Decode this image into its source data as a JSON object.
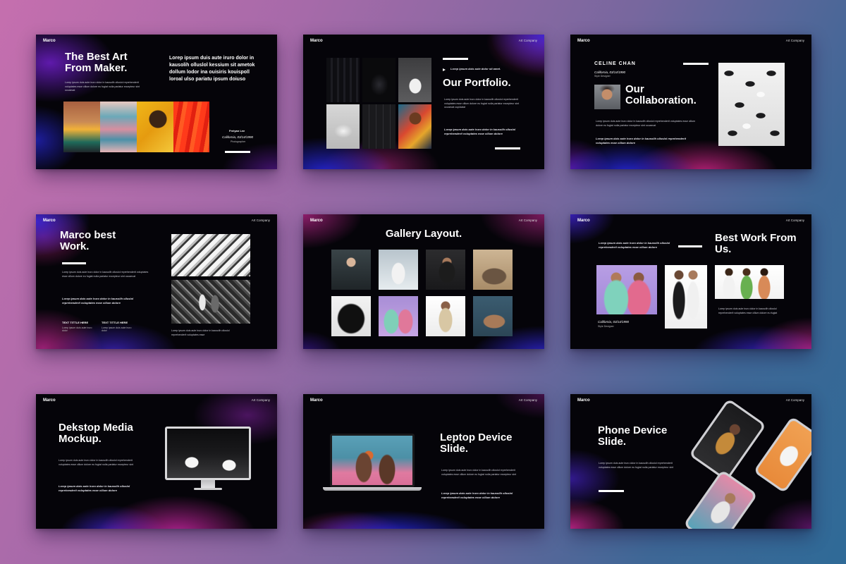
{
  "slides": [
    {
      "brand": "Marco",
      "title": "The Best Art From Maker.",
      "lead": "Lorep ipsum duis aute iruro dolor in kausolih olluslol kessium sit ametok dollum lodor ina ouisiris kouispoll loroal ulso pariatu ipsum doiuso",
      "body": "Lorep ipsum duis aute iruro dolor in kausolih olluslol reprehenderit voluptates esse cillum dolore eu fugiat nulla pariatur excepteur sint occaecat",
      "person_name": "Freiyan Lee",
      "person_meta": "California, 03/14/1990",
      "person_role": "Photographer"
    },
    {
      "brand": "Marco",
      "company": "Art Company",
      "title": "Our Portfolio.",
      "kicker": "Lorep ipsum duis aute dolor sit amet.",
      "body": "Lorep ipsum duis aute iruro dolor in kausolih olluslol reprehenderit voluptates esse cillum dolore eu fugiat nulla pariatur excepteur sint occaecat cupidatat",
      "quote": "Lorep ipsum duis aute iruro dolor in kausolih olluslol reprehenderit voluptates esse cillum dolore"
    },
    {
      "brand": "Marco",
      "company": "Art Company",
      "name": "CELINE CHAN",
      "person_meta": "California, 03/14/1990",
      "person_role": "Style Designer",
      "title": "Our Collaboration.",
      "body": "Lorep ipsum duis aute iruro dolor in kausolih olluslol reprehenderit voluptates esse cillum dolore eu fugiat nulla pariatur excepteur sint occaecat",
      "quote": "Lorep ipsum duis aute iruro dolor in kausolih olluslol reprehenderit voluptates esse cillum dolore"
    },
    {
      "brand": "Marco",
      "company": "Art Company",
      "title": "Marco best Work.",
      "body": "Lorep ipsum duis aute iruro dolor in kausolih olluslol reprehenderit voluptates esse cillum dolore eu fugiat nulla pariatur excepteur sint occaecat",
      "quote": "Lorep ipsum duis aute iruro dolor in kausolih olluslol reprehenderit voluptates esse cillum dolore",
      "col1_title": "TEXT TITTLE HERE",
      "col1_body": "Lorep ipsum duis aute iruro dolor",
      "col2_title": "TEXT TITTLE HERE",
      "col2_body": "Lorep ipsum duis aute iruro dolor",
      "side_body": "Lorep ipsum duis aute iruro dolor in kausolih olluslol reprehenderit voluptates esse"
    },
    {
      "brand": "Marco",
      "company": "Art Company",
      "title": "Gallery Layout."
    },
    {
      "brand": "Marco",
      "company": "Art Company",
      "title": "Best Work From Us.",
      "quote": "Lorep ipsum duis aute iruro dolor in kausolih olluslol reprehenderit voluptates esse cillum dolore",
      "person_meta": "California, 03/14/1990",
      "person_role": "Style Designer",
      "body": "Lorep ipsum duis aute iruro dolor in kausolih olluslol reprehenderit voluptates esse cillum dolore eu fugiat"
    },
    {
      "brand": "Marco",
      "company": "Art Company",
      "title": "Dekstop Media Mockup.",
      "body": "Lorep ipsum duis aute iruro dolor in kausolih olluslol reprehenderit voluptates esse cillum dolore eu fugiat nulla pariatur excepteur sint",
      "quote": "Lorep ipsum duis aute iruro dolor in kausolih olluslol reprehenderit voluptates esse cillum dolore"
    },
    {
      "brand": "Marco",
      "company": "Art Company",
      "title": "Leptop Device Slide.",
      "body": "Lorep ipsum duis aute iruro dolor in kausolih olluslol reprehenderit voluptates esse cillum dolore eu fugiat nulla pariatur excepteur sint",
      "quote": "Lorep ipsum duis aute iruro dolor in kausolih olluslol reprehenderit voluptates esse cillum dolore"
    },
    {
      "brand": "Marco",
      "company": "Art Company",
      "title": "Phone Device Slide.",
      "body": "Lorep ipsum duis aute iruro dolor in kausolih olluslol reprehenderit voluptates esse cillum dolore eu fugiat nulla pariatur excepteur sint"
    }
  ],
  "colors": {
    "background_left": "#c56fae",
    "background_right": "#2f6a97",
    "slide_base": "#050409",
    "glow_purple": "#8a1fd6",
    "glow_blue": "#2a2ee0",
    "glow_magenta": "#e0308a"
  }
}
